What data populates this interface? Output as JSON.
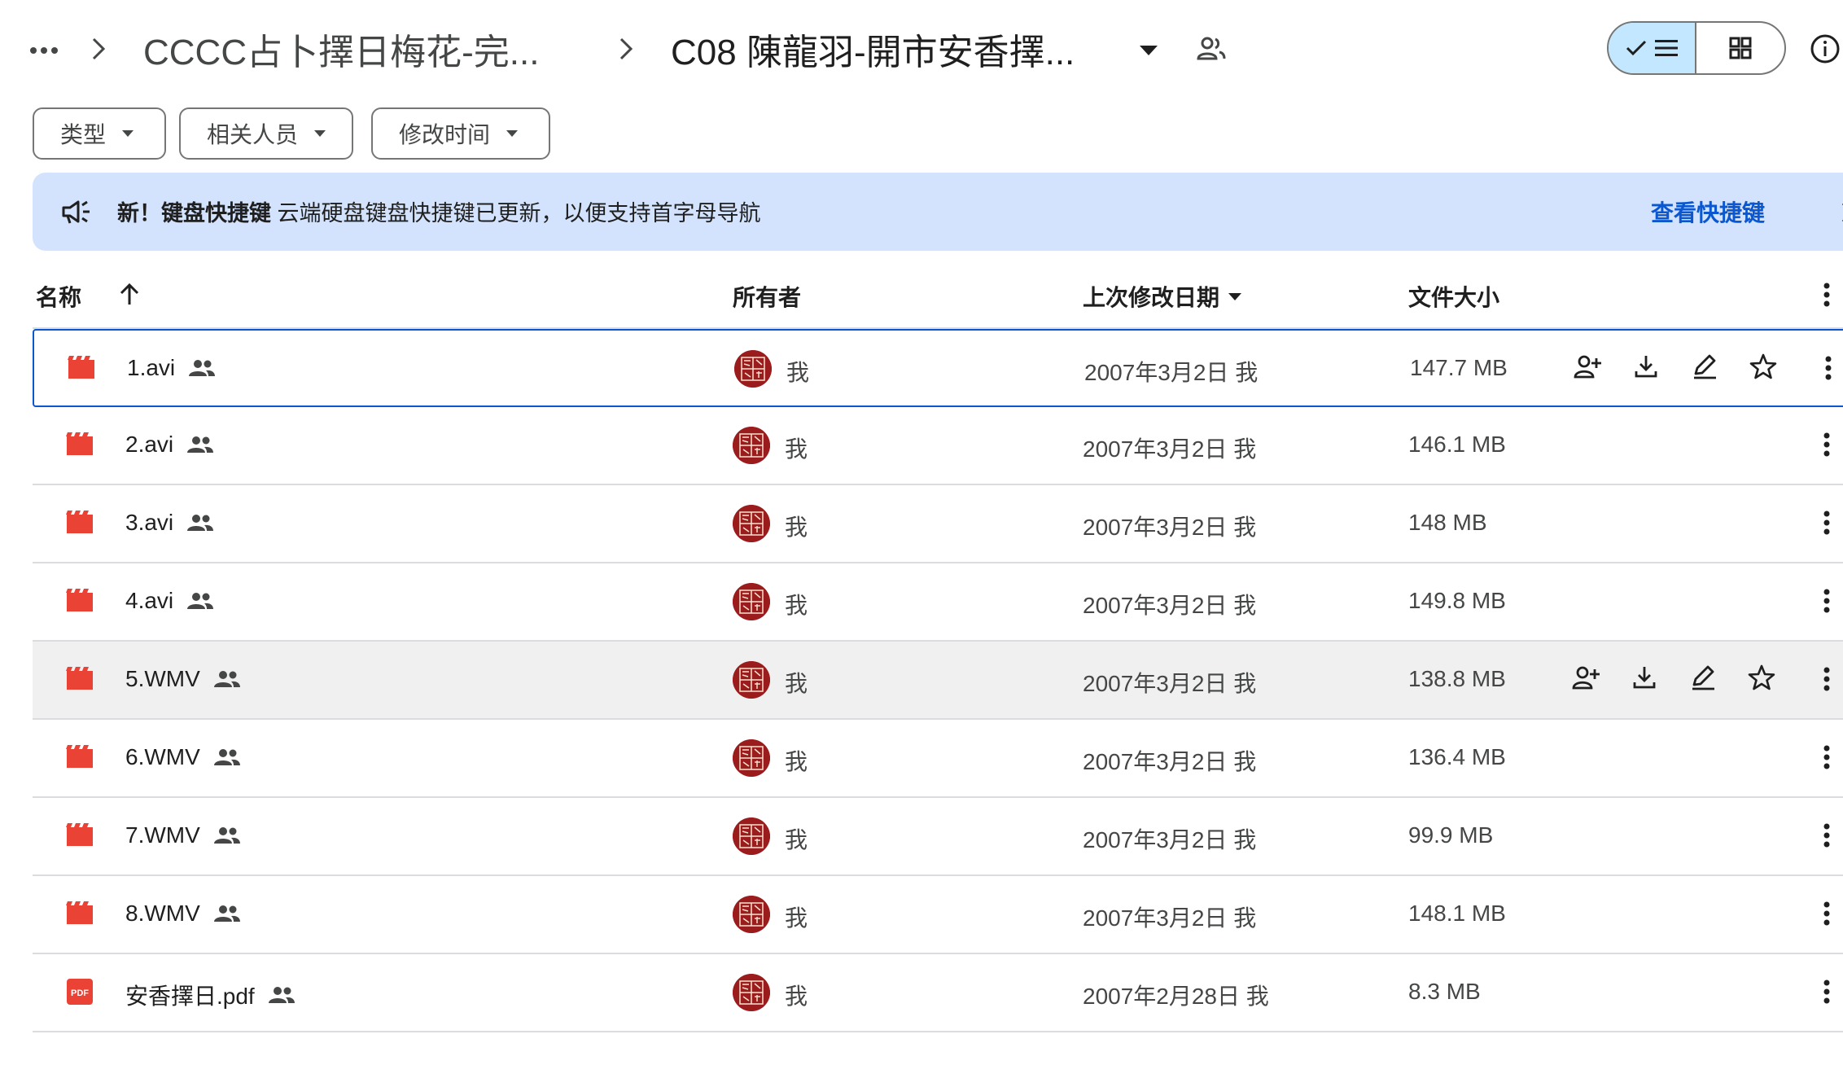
{
  "header": {
    "more_icon": "more-horiz-icon",
    "parent_folder": "CCCC占卜擇日梅花-完...",
    "current_folder": "C08 陳龍羽-開市安香擇...",
    "view_toggle": {
      "list": "list-view-icon",
      "grid": "grid-view-icon",
      "active": "list"
    },
    "info_icon": "info-icon"
  },
  "filters": [
    {
      "label": "类型"
    },
    {
      "label": "相关人员"
    },
    {
      "label": "修改时间"
    }
  ],
  "banner": {
    "new_label": "新！键盘快捷键",
    "message": " 云端硬盘键盘快捷键已更新，以便支持首字母导航",
    "link": "查看快捷键"
  },
  "columns": {
    "name": "名称",
    "owner": "所有者",
    "modified": "上次修改日期",
    "size": "文件大小"
  },
  "files": [
    {
      "name": "1.avi",
      "type": "video",
      "owner": "我",
      "modified": "2007年3月2日 我",
      "size": "147.7 MB",
      "state": "selected"
    },
    {
      "name": "2.avi",
      "type": "video",
      "owner": "我",
      "modified": "2007年3月2日 我",
      "size": "146.1 MB",
      "state": ""
    },
    {
      "name": "3.avi",
      "type": "video",
      "owner": "我",
      "modified": "2007年3月2日 我",
      "size": "148 MB",
      "state": ""
    },
    {
      "name": "4.avi",
      "type": "video",
      "owner": "我",
      "modified": "2007年3月2日 我",
      "size": "149.8 MB",
      "state": ""
    },
    {
      "name": "5.WMV",
      "type": "video",
      "owner": "我",
      "modified": "2007年3月2日 我",
      "size": "138.8 MB",
      "state": "hover"
    },
    {
      "name": "6.WMV",
      "type": "video",
      "owner": "我",
      "modified": "2007年3月2日 我",
      "size": "136.4 MB",
      "state": ""
    },
    {
      "name": "7.WMV",
      "type": "video",
      "owner": "我",
      "modified": "2007年3月2日 我",
      "size": "99.9 MB",
      "state": ""
    },
    {
      "name": "8.WMV",
      "type": "video",
      "owner": "我",
      "modified": "2007年3月2日 我",
      "size": "148.1 MB",
      "state": ""
    },
    {
      "name": "安香擇日.pdf",
      "type": "pdf",
      "pdf_badge": "PDF",
      "owner": "我",
      "modified": "2007年2月28日 我",
      "size": "8.3 MB",
      "state": ""
    }
  ],
  "colors": {
    "accent": "#0b57d0",
    "banner_bg": "#d3e3fd",
    "toggle_active_bg": "#c2e7ff",
    "file_icon_red": "#ea4335",
    "avatar_red": "#9b1c1c"
  }
}
